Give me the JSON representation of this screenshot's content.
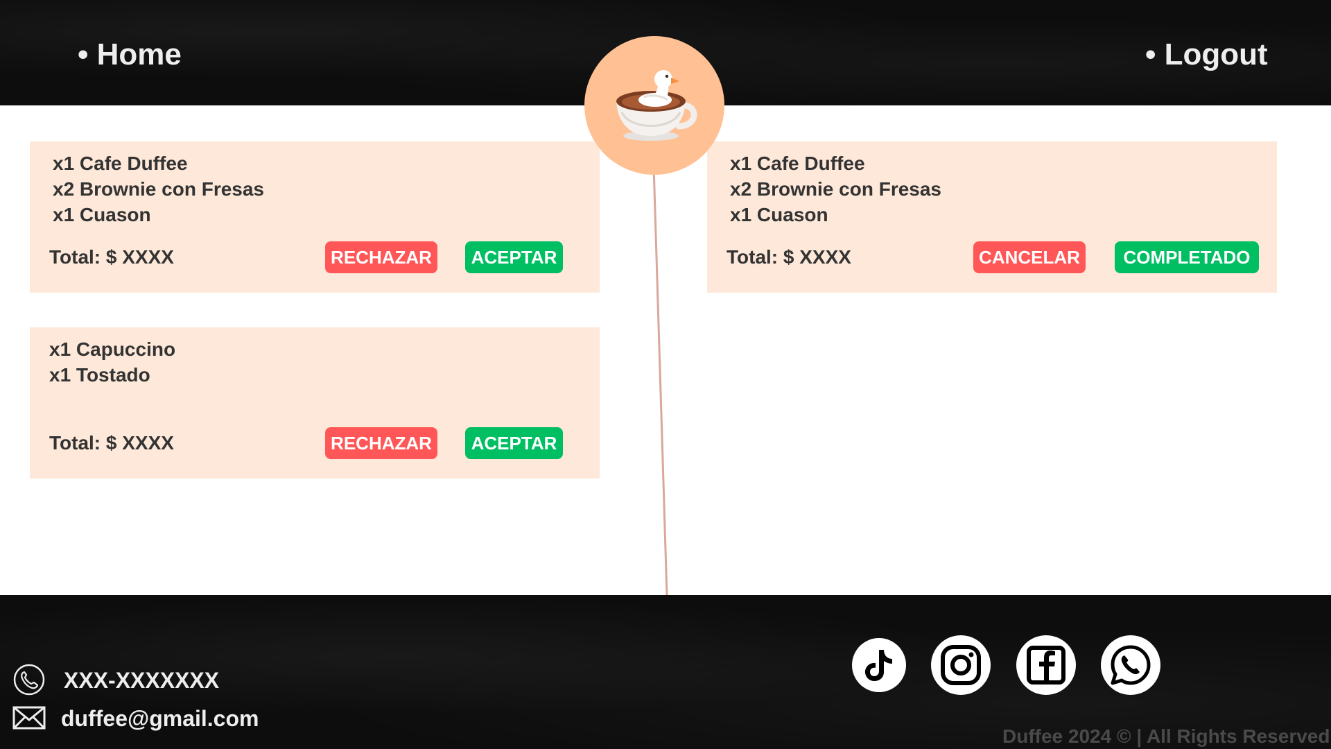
{
  "nav": {
    "home_label": "• Home",
    "logout_label": "• Logout"
  },
  "logo": {
    "icon": "duck-in-coffee-cup-icon"
  },
  "colors": {
    "card_background": "#fde8d9",
    "logo_circle": "#ffc093",
    "reject_red": "#ff5757",
    "accept_green": "#00bf63",
    "header_footer": "#0d0d0d",
    "divider_line": "#d9a89a"
  },
  "incoming_orders": [
    {
      "items": [
        "x1 Cafe Duffee",
        "x2 Brownie con Fresas",
        "x1 Cuason"
      ],
      "total": "Total: $ XXXX",
      "reject_label": "RECHAZAR",
      "accept_label": "ACEPTAR"
    },
    {
      "items": [
        "x1 Capuccino",
        "x1 Tostado"
      ],
      "total": "Total: $ XXXX",
      "reject_label": "RECHAZAR",
      "accept_label": "ACEPTAR"
    }
  ],
  "active_orders": [
    {
      "items": [
        "x1 Cafe Duffee",
        "x2 Brownie con Fresas",
        "x1 Cuason"
      ],
      "total": "Total: $ XXXX",
      "cancel_label": "CANCELAR",
      "complete_label": "COMPLETADO"
    }
  ],
  "footer": {
    "phone": "XXX-XXXXXXX",
    "email": "duffee@gmail.com",
    "social_icons": [
      "tiktok-icon",
      "instagram-icon",
      "facebook-icon",
      "whatsapp-icon"
    ],
    "copyright": "Duffee 2024 © | All Rights Reserved"
  }
}
